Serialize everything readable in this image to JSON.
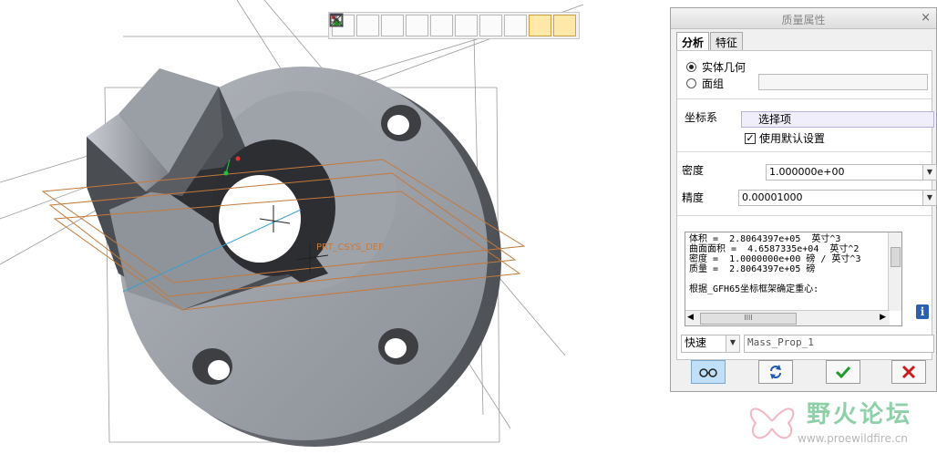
{
  "viewport": {
    "csys_label": "PRT_CSYS_DEF",
    "toolbar": {
      "buttons": [
        {
          "name": "zoom-fit-icon"
        },
        {
          "name": "zoom-in-icon"
        },
        {
          "name": "zoom-out-icon"
        },
        {
          "name": "repaint-icon"
        },
        {
          "name": "display-style-icon"
        },
        {
          "name": "saved-views-icon"
        },
        {
          "name": "view-manager-icon"
        },
        {
          "name": "datum-display-icon"
        },
        {
          "name": "spin-center-icon"
        },
        {
          "name": "annotation-display-icon"
        }
      ]
    }
  },
  "dialog": {
    "title": "质量属性",
    "tabs": [
      "分析",
      "特征"
    ],
    "solid_geometry_label": "实体几何",
    "quilt_label": "面组",
    "csys_label": "坐标系",
    "csys_select_placeholder": "选择项",
    "use_default_label": "使用默认设置",
    "density_label": "密度",
    "density_value": "1.000000e+00",
    "accuracy_label": "精度",
    "accuracy_value": "0.00001000",
    "results": [
      "体积 =  2.8064397e+05  英寸^3",
      "曲面面积 =  4.6587335e+04  英寸^2",
      "密度 =  1.0000000e+00 磅 / 英寸^3",
      "质量 =  2.8064397e+05 磅",
      "",
      "根据_GFH65坐标框架确定重心:"
    ],
    "scroll_thumb_glyph": "IIII",
    "mode_value": "快速",
    "analysis_name": "Mass_Prop_1"
  },
  "watermark": {
    "text": "野火论坛",
    "url": "www.proewildfire.cn"
  },
  "colors": {
    "part_face": "#8d9198",
    "part_top": "#a5a9b0",
    "part_dark": "#3a3c40",
    "datum_plane": "#c47a3a",
    "accent_blue": "#2b5fb0"
  }
}
